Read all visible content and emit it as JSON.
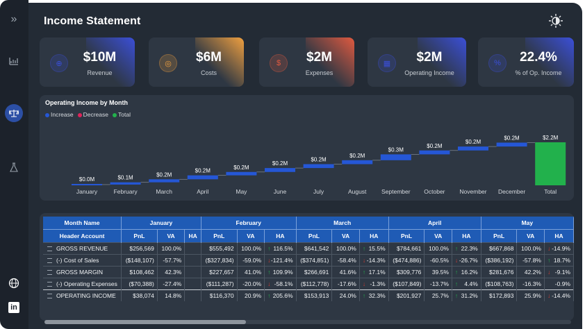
{
  "page": {
    "title": "Income Statement"
  },
  "sidebar": {
    "items": [
      {
        "name": "expand-icon",
        "glyph": "»"
      },
      {
        "name": "chart-icon",
        "glyph": "📈"
      },
      {
        "name": "balance-icon",
        "glyph": "⚖"
      },
      {
        "name": "flask-icon",
        "glyph": "⚗"
      }
    ],
    "bottom": [
      {
        "name": "globe-icon",
        "glyph": "🌐"
      },
      {
        "name": "linkedin-icon",
        "glyph": "in"
      }
    ]
  },
  "kpis": [
    {
      "value": "$10M",
      "label": "Revenue",
      "icon": "money-bag-icon",
      "glyph": "⊕",
      "color": "#3b4fd8"
    },
    {
      "value": "$6M",
      "label": "Costs",
      "icon": "coin-icon",
      "glyph": "◎",
      "color": "#f0a040"
    },
    {
      "value": "$2M",
      "label": "Expenses",
      "icon": "dollar-hand-icon",
      "glyph": "$",
      "color": "#e05a40"
    },
    {
      "value": "$2M",
      "label": "Operating Income",
      "icon": "bank-icon",
      "glyph": "▦",
      "color": "#3b4fd8"
    },
    {
      "value": "22.4%",
      "label": "% of Op. Income",
      "icon": "percent-icon",
      "glyph": "%",
      "color": "#3b4fd8"
    }
  ],
  "colors": {
    "increase": "#2557d6",
    "decrease": "#e0235a",
    "total": "#22b14c"
  },
  "chart_data": {
    "type": "bar",
    "subtype": "waterfall",
    "title": "Operating Income by Month",
    "legend": [
      "Increase",
      "Decrease",
      "Total"
    ],
    "legend_position": "top-left",
    "categories": [
      "January",
      "February",
      "March",
      "April",
      "May",
      "June",
      "July",
      "August",
      "September",
      "October",
      "November",
      "December",
      "Total"
    ],
    "values": [
      0.038,
      0.116,
      0.154,
      0.202,
      0.173,
      0.2,
      0.2,
      0.2,
      0.3,
      0.2,
      0.2,
      0.2,
      2.2
    ],
    "data_labels": [
      "$0.0M",
      "$0.1M",
      "$0.2M",
      "$0.2M",
      "$0.2M",
      "$0.2M",
      "$0.2M",
      "$0.2M",
      "$0.3M",
      "$0.2M",
      "$0.2M",
      "$0.2M",
      "$2.2M"
    ],
    "kinds": [
      "increase",
      "increase",
      "increase",
      "increase",
      "increase",
      "increase",
      "increase",
      "increase",
      "increase",
      "increase",
      "increase",
      "increase",
      "total"
    ],
    "unit": "$M",
    "grid": false
  },
  "table": {
    "header1": [
      "Month Name",
      "January",
      "February",
      "March",
      "April",
      "May"
    ],
    "header2": [
      "Header Account",
      "PnL",
      "VA",
      "HA",
      "PnL",
      "VA",
      "HA",
      "PnL",
      "VA",
      "HA",
      "PnL",
      "VA",
      "HA",
      "PnL",
      "VA",
      "HA"
    ],
    "rows": [
      {
        "label": "GROSS REVENUE",
        "cells": [
          {
            "pnl": "$256,569",
            "va": "100.0%",
            "ha": "",
            "dir": ""
          },
          {
            "pnl": "$555,492",
            "va": "100.0%",
            "ha": "116.5%",
            "dir": "up"
          },
          {
            "pnl": "$641,542",
            "va": "100.0%",
            "ha": "15.5%",
            "dir": "up"
          },
          {
            "pnl": "$784,661",
            "va": "100.0%",
            "ha": "22.3%",
            "dir": "up"
          },
          {
            "pnl": "$667,868",
            "va": "100.0%",
            "ha": "-14.9%",
            "dir": "down"
          }
        ]
      },
      {
        "label": "(-) Cost of Sales",
        "cells": [
          {
            "pnl": "($148,107)",
            "va": "-57.7%",
            "ha": "",
            "dir": ""
          },
          {
            "pnl": "($327,834)",
            "va": "-59.0%",
            "ha": "-121.4%",
            "dir": "down"
          },
          {
            "pnl": "($374,851)",
            "va": "-58.4%",
            "ha": "-14.3%",
            "dir": "down"
          },
          {
            "pnl": "($474,886)",
            "va": "-60.5%",
            "ha": "-26.7%",
            "dir": "down"
          },
          {
            "pnl": "($386,192)",
            "va": "-57.8%",
            "ha": "18.7%",
            "dir": "up"
          }
        ]
      },
      {
        "label": "GROSS MARGIN",
        "cells": [
          {
            "pnl": "$108,462",
            "va": "42.3%",
            "ha": "",
            "dir": ""
          },
          {
            "pnl": "$227,657",
            "va": "41.0%",
            "ha": "109.9%",
            "dir": "up"
          },
          {
            "pnl": "$266,691",
            "va": "41.6%",
            "ha": "17.1%",
            "dir": "up"
          },
          {
            "pnl": "$309,776",
            "va": "39.5%",
            "ha": "16.2%",
            "dir": "up"
          },
          {
            "pnl": "$281,676",
            "va": "42.2%",
            "ha": "-9.1%",
            "dir": "down"
          }
        ]
      },
      {
        "label": "(-) Operating Expenses",
        "cells": [
          {
            "pnl": "($70,388)",
            "va": "-27.4%",
            "ha": "",
            "dir": ""
          },
          {
            "pnl": "($111,287)",
            "va": "-20.0%",
            "ha": "-58.1%",
            "dir": "down"
          },
          {
            "pnl": "($112,778)",
            "va": "-17.6%",
            "ha": "-1.3%",
            "dir": "down"
          },
          {
            "pnl": "($107,849)",
            "va": "-13.7%",
            "ha": "4.4%",
            "dir": "up"
          },
          {
            "pnl": "($108,763)",
            "va": "-16.3%",
            "ha": "-0.9%",
            "dir": ""
          }
        ]
      },
      {
        "label": "OPERATING INCOME",
        "cells": [
          {
            "pnl": "$38,074",
            "va": "14.8%",
            "ha": "",
            "dir": ""
          },
          {
            "pnl": "$116,370",
            "va": "20.9%",
            "ha": "205.6%",
            "dir": "up"
          },
          {
            "pnl": "$153,913",
            "va": "24.0%",
            "ha": "32.3%",
            "dir": "up"
          },
          {
            "pnl": "$201,927",
            "va": "25.7%",
            "ha": "31.2%",
            "dir": "up"
          },
          {
            "pnl": "$172,893",
            "va": "25.9%",
            "ha": "-14.4%",
            "dir": "down"
          }
        ]
      }
    ]
  }
}
